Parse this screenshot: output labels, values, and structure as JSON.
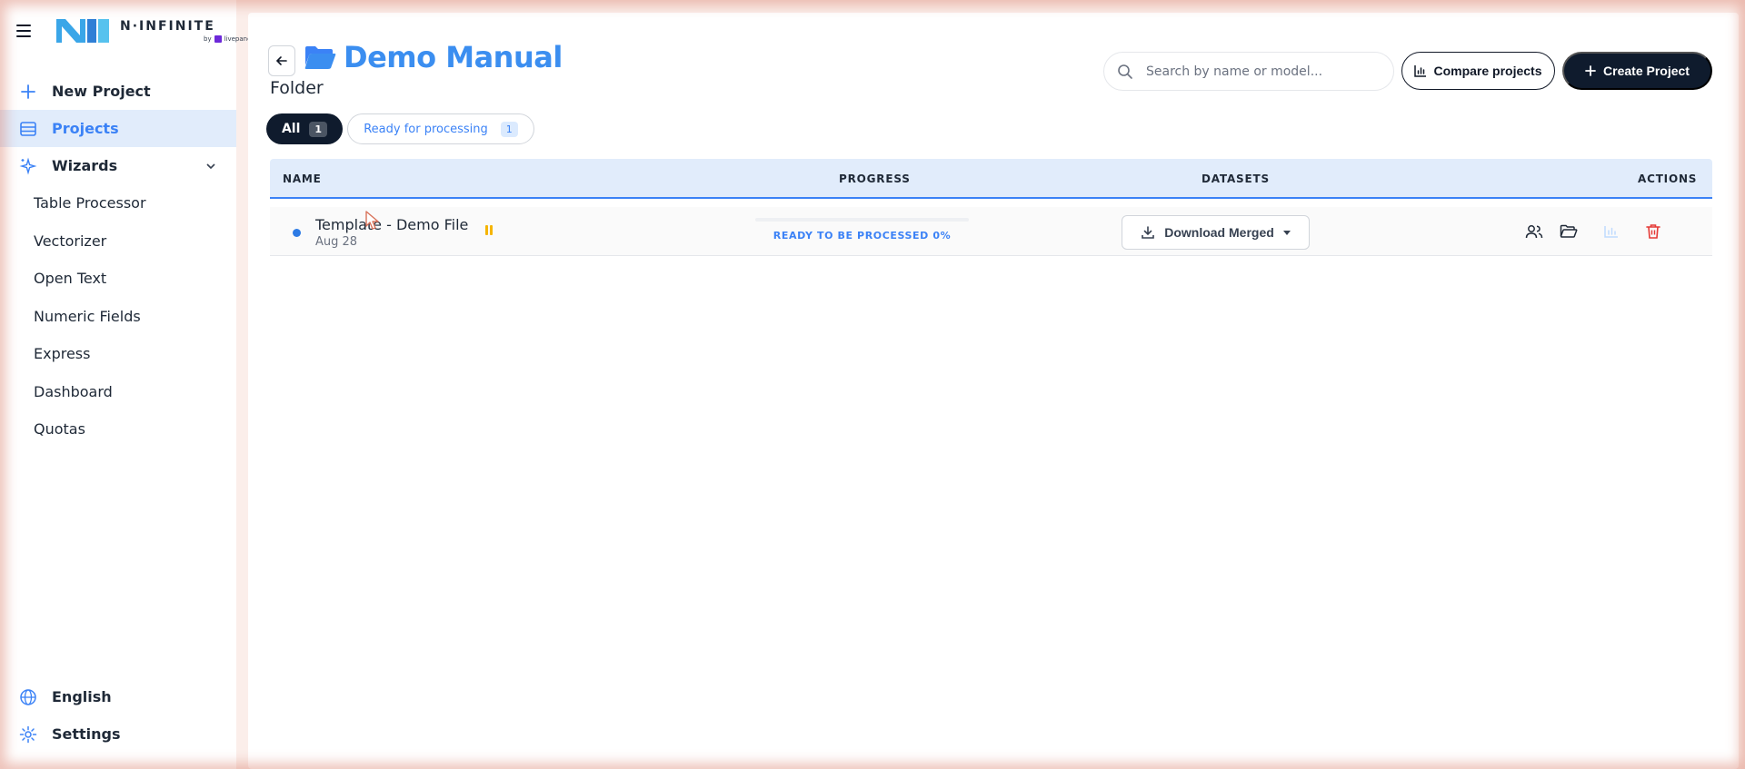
{
  "sidebar": {
    "brand": {
      "name": "N·INFINITE",
      "by": "by",
      "partner": "livepanel"
    },
    "nav": [
      {
        "label": "New Project",
        "icon": "plus-icon"
      },
      {
        "label": "Projects",
        "icon": "list-icon",
        "active": true
      },
      {
        "label": "Wizards",
        "icon": "sparkles-icon",
        "expanded": true
      }
    ],
    "wizards": [
      "Table Processor",
      "Vectorizer",
      "Open Text",
      "Numeric Fields",
      "Express",
      "Dashboard",
      "Quotas"
    ],
    "bottom": [
      {
        "label": "English",
        "icon": "globe-icon"
      },
      {
        "label": "Settings",
        "icon": "gear-icon"
      }
    ]
  },
  "header": {
    "title": "Demo Manual",
    "subtitle": "Folder",
    "search_placeholder": "Search by name or model...",
    "compare_label": "Compare projects",
    "create_label": "Create Project"
  },
  "filters": [
    {
      "label": "All",
      "count": "1",
      "active": true
    },
    {
      "label": "Ready for processing",
      "count": "1"
    }
  ],
  "table": {
    "columns": [
      "NAME",
      "PROGRESS",
      "DATASETS",
      "ACTIONS"
    ],
    "rows": [
      {
        "name": "Template - Demo File",
        "date": "Aug 28",
        "progress_label": "READY TO BE PROCESSED 0%",
        "progress": 0,
        "dataset_button": "Download Merged"
      }
    ]
  },
  "colors": {
    "accent": "#3b82f6",
    "dark": "#0f1b2d",
    "danger": "#e53935",
    "pause": "#f5b400"
  }
}
